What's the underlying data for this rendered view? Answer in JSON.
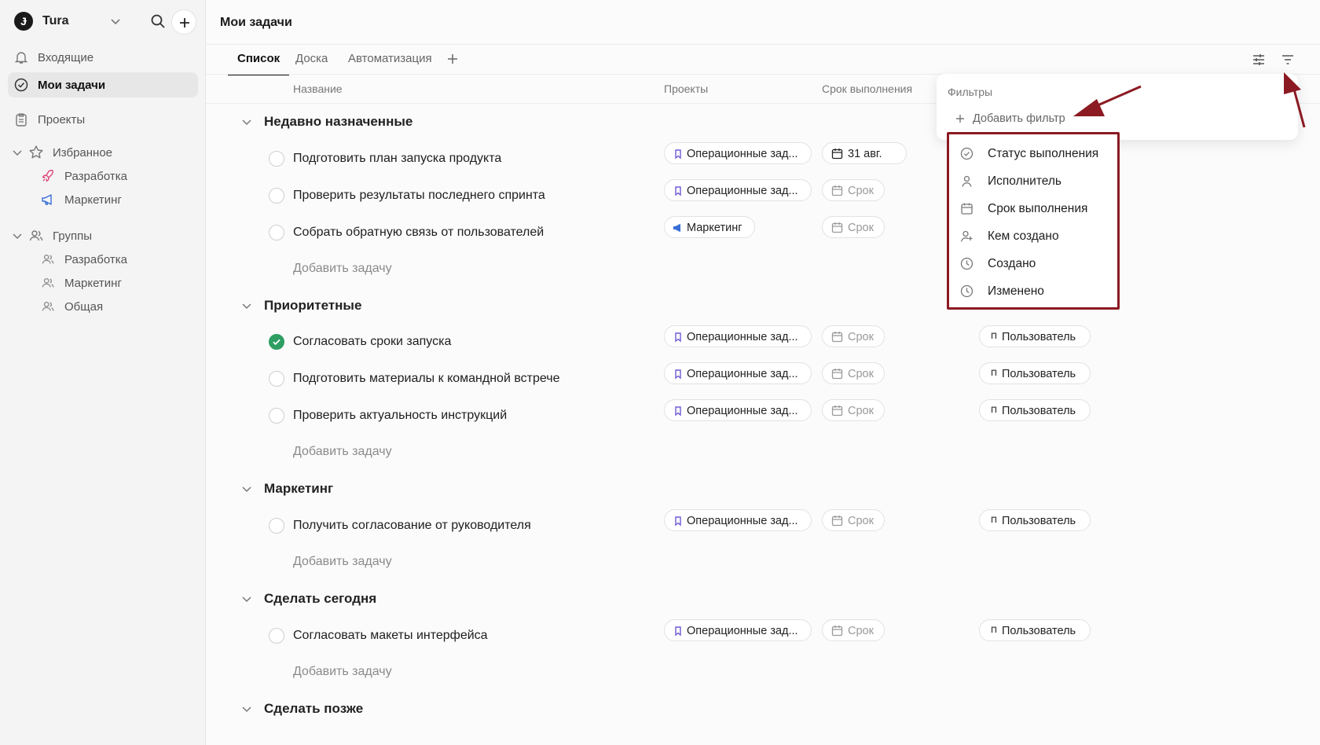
{
  "workspace": {
    "logo": "Ɉ",
    "name": "Tura"
  },
  "sidebar": {
    "inbox": "Входящие",
    "my_tasks": "Мои задачи",
    "projects": "Проекты",
    "favorites": {
      "label": "Избранное",
      "items": [
        "Разработка",
        "Маркетинг"
      ]
    },
    "groups": {
      "label": "Группы",
      "items": [
        "Разработка",
        "Маркетинг",
        "Общая"
      ]
    }
  },
  "header": {
    "title": "Мои задачи"
  },
  "tabs": [
    "Список",
    "Доска",
    "Автоматизация"
  ],
  "columns": {
    "name": "Название",
    "projects": "Проекты",
    "due": "Срок выполнения"
  },
  "add_task_label": "Добавить задачу",
  "groups": [
    {
      "title": "Недавно назначенные",
      "tasks": [
        {
          "name": "Подготовить план запуска продукта",
          "project": "Операционные зад...",
          "due": "31 авг.",
          "done": false
        },
        {
          "name": "Проверить результаты последнего спринта",
          "project": "Операционные зад...",
          "due": "Срок",
          "done": false
        },
        {
          "name": "Собрать обратную связь от пользователей",
          "project": "Маркетинг",
          "due": "Срок",
          "done": false
        }
      ]
    },
    {
      "title": "Приоритетные",
      "tasks": [
        {
          "name": "Согласовать сроки запуска",
          "project": "Операционные зад...",
          "due": "Срок",
          "assignee": "Пользователь",
          "done": true
        },
        {
          "name": "Подготовить материалы к командной встрече",
          "project": "Операционные зад...",
          "due": "Срок",
          "assignee": "Пользователь",
          "done": false
        },
        {
          "name": "Проверить актуальность инструкций",
          "project": "Операционные зад...",
          "due": "Срок",
          "assignee": "Пользователь",
          "done": false
        }
      ]
    },
    {
      "title": "Маркетинг",
      "tasks": [
        {
          "name": "Получить согласование от руководителя",
          "project": "Операционные зад...",
          "due": "Срок",
          "assignee": "Пользователь",
          "done": false
        }
      ]
    },
    {
      "title": "Сделать сегодня",
      "tasks": [
        {
          "name": "Согласовать макеты интерфейса",
          "project": "Операционные зад...",
          "due": "Срок",
          "assignee": "Пользователь",
          "done": false
        }
      ]
    },
    {
      "title": "Сделать позже",
      "tasks": []
    }
  ],
  "user_initial": "П",
  "filters": {
    "title": "Фильтры",
    "add_label": "Добавить фильтр",
    "options": [
      "Статус выполнения",
      "Исполнитель",
      "Срок выполнения",
      "Кем создано",
      "Создано",
      "Изменено"
    ]
  },
  "colors": {
    "accent_done": "#2e9e62",
    "annotation": "#8b1a22",
    "favorite_dev": "#e0457b",
    "favorite_marketing": "#3b6fd8"
  }
}
